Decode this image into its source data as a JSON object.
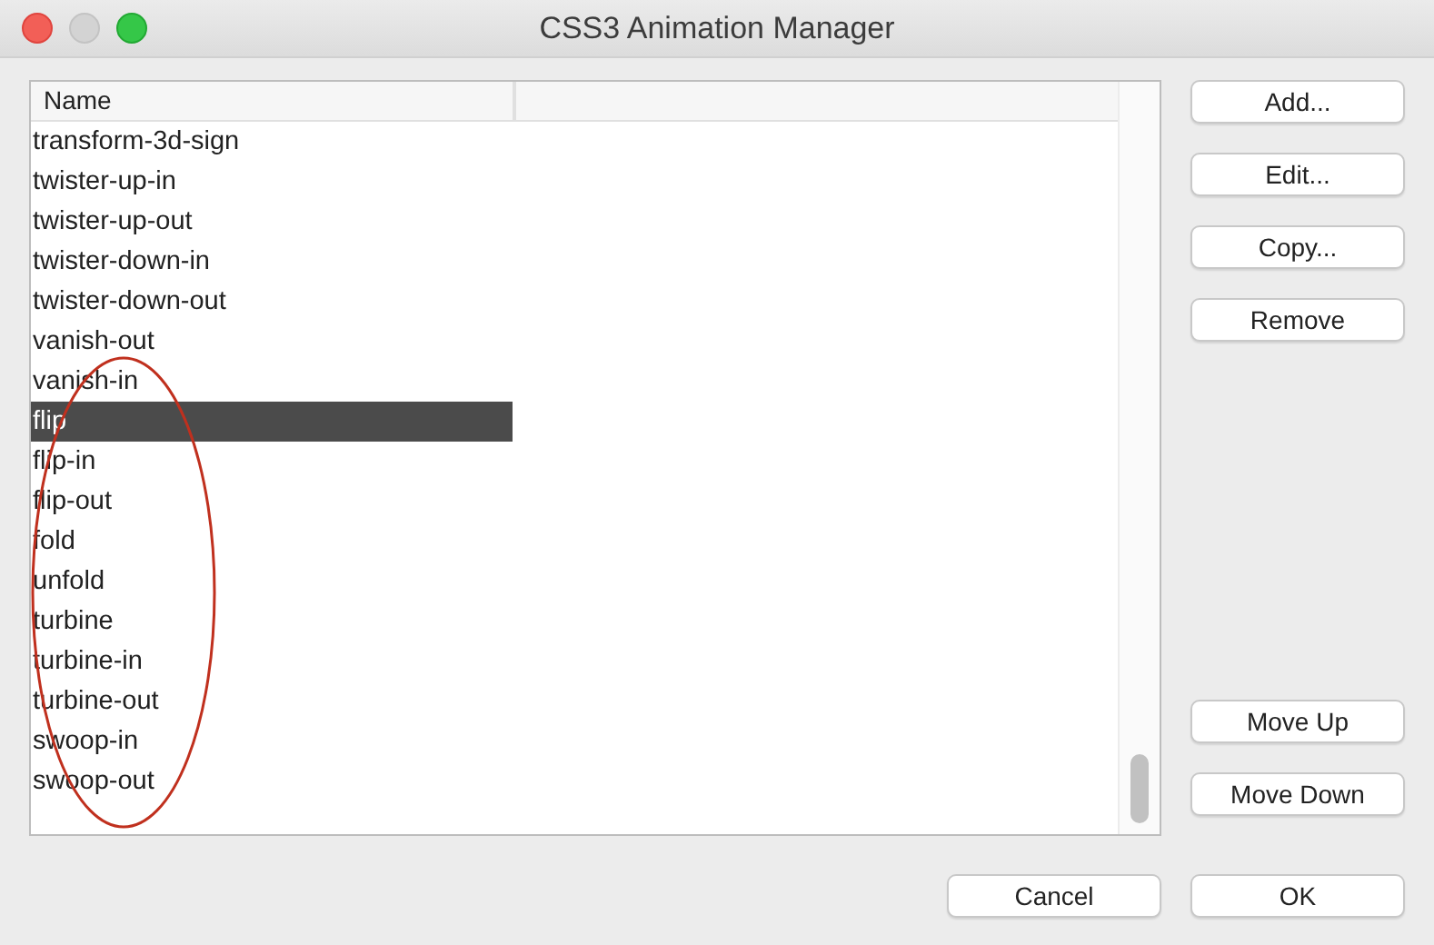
{
  "window": {
    "title": "CSS3 Animation Manager"
  },
  "table": {
    "columns": [
      "Name"
    ],
    "rows": [
      {
        "name": "transform-3d-sign",
        "selected": false
      },
      {
        "name": "twister-up-in",
        "selected": false
      },
      {
        "name": "twister-up-out",
        "selected": false
      },
      {
        "name": "twister-down-in",
        "selected": false
      },
      {
        "name": "twister-down-out",
        "selected": false
      },
      {
        "name": "vanish-out",
        "selected": false
      },
      {
        "name": "vanish-in",
        "selected": false
      },
      {
        "name": "flip",
        "selected": true
      },
      {
        "name": "flip-in",
        "selected": false
      },
      {
        "name": "flip-out",
        "selected": false
      },
      {
        "name": "fold",
        "selected": false
      },
      {
        "name": "unfold",
        "selected": false
      },
      {
        "name": "turbine",
        "selected": false
      },
      {
        "name": "turbine-in",
        "selected": false
      },
      {
        "name": "turbine-out",
        "selected": false
      },
      {
        "name": "swoop-in",
        "selected": false
      },
      {
        "name": "swoop-out",
        "selected": false
      }
    ]
  },
  "side_buttons_top": [
    "Add...",
    "Edit...",
    "Copy...",
    "Remove"
  ],
  "side_buttons_bottom": [
    "Move Up",
    "Move Down"
  ],
  "footer_buttons": [
    "Cancel",
    "OK"
  ]
}
